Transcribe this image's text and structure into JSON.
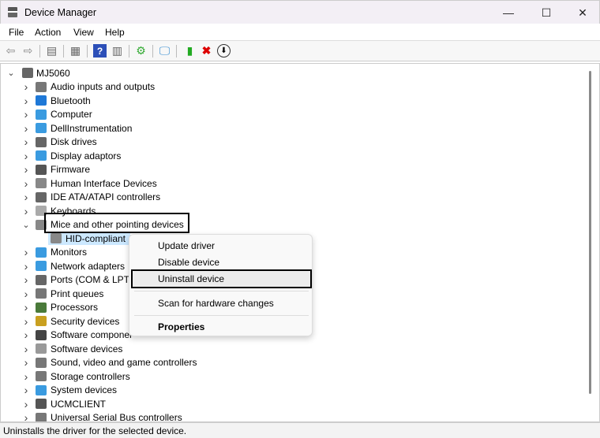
{
  "window": {
    "title": "Device Manager",
    "minimize": "—",
    "maximize": "☐",
    "close": "✕"
  },
  "menu": [
    "File",
    "Action",
    "View",
    "Help"
  ],
  "toolbar": {
    "icons": [
      "back-arrow-icon",
      "forward-arrow-icon",
      "show-hide-console-tree-icon",
      "properties-icon",
      "help-icon",
      "action-pane-icon",
      "update-driver-icon",
      "scan-hardware-icon",
      "enable-device-icon",
      "uninstall-icon",
      "download-icon"
    ]
  },
  "tree": {
    "root": "MJ5060",
    "items": [
      {
        "label": "Audio inputs and outputs",
        "color": "#777"
      },
      {
        "label": "Bluetooth",
        "color": "#1e78d7"
      },
      {
        "label": "Computer",
        "color": "#3a9be0"
      },
      {
        "label": "DellInstrumentation",
        "color": "#3a9be0"
      },
      {
        "label": "Disk drives",
        "color": "#666"
      },
      {
        "label": "Display adaptors",
        "color": "#3a9be0"
      },
      {
        "label": "Firmware",
        "color": "#555"
      },
      {
        "label": "Human Interface Devices",
        "color": "#888"
      },
      {
        "label": "IDE ATA/ATAPI controllers",
        "color": "#666"
      },
      {
        "label": "Keyboards",
        "color": "#aaa"
      },
      {
        "label": "Mice and other pointing devices",
        "color": "#888",
        "expanded": true,
        "children": [
          "HID-compliant"
        ]
      },
      {
        "label": "Monitors",
        "color": "#3a9be0"
      },
      {
        "label": "Network adapters",
        "color": "#3a9be0"
      },
      {
        "label": "Ports (COM & LPT)",
        "color": "#666"
      },
      {
        "label": "Print queues",
        "color": "#777"
      },
      {
        "label": "Processors",
        "color": "#4a7a3a"
      },
      {
        "label": "Security devices",
        "color": "#c9a020"
      },
      {
        "label": "Software componer",
        "color": "#444"
      },
      {
        "label": "Software devices",
        "color": "#999"
      },
      {
        "label": "Sound, video and game controllers",
        "color": "#777"
      },
      {
        "label": "Storage controllers",
        "color": "#777"
      },
      {
        "label": "System devices",
        "color": "#3a9be0"
      },
      {
        "label": "UCMCLIENT",
        "color": "#555"
      },
      {
        "label": "Universal Serial Bus controllers",
        "color": "#777"
      }
    ]
  },
  "context_menu": {
    "items": [
      "Update driver",
      "Disable device",
      "Uninstall device",
      "Scan for hardware changes",
      "Properties"
    ]
  },
  "status": "Uninstalls the driver for the selected device."
}
